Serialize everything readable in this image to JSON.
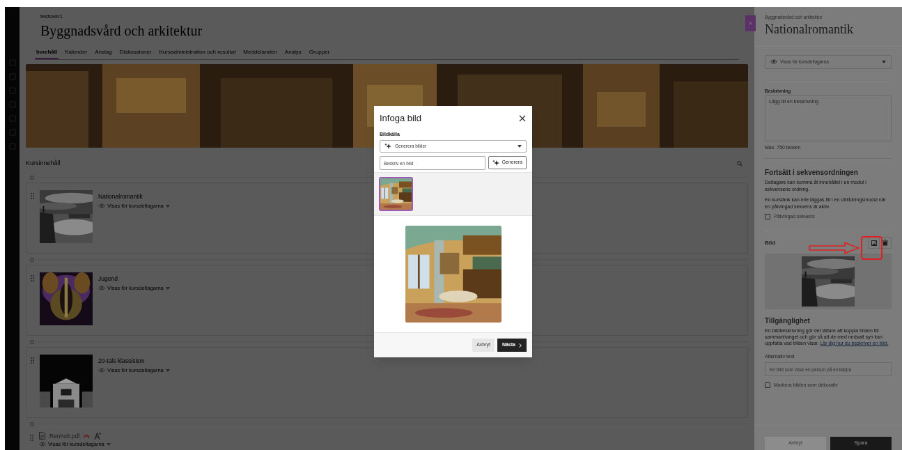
{
  "course": {
    "breadcrumb": "testcein1",
    "title": "Byggnadsvård och arkitektur"
  },
  "tabs": [
    {
      "label": "Innehåll",
      "selected": true
    },
    {
      "label": "Kalender",
      "selected": false
    },
    {
      "label": "Anslag",
      "selected": false
    },
    {
      "label": "Diskussioner",
      "selected": false
    },
    {
      "label": "Kursadministration och resultat",
      "selected": false
    },
    {
      "label": "Meddelanden",
      "selected": false
    },
    {
      "label": "Analys",
      "selected": false
    },
    {
      "label": "Grupper",
      "selected": false
    }
  ],
  "content_heading": "Kursinnehåll",
  "items": [
    {
      "kind": "module",
      "title": "Nationalromantik",
      "visibility": "Visas för kursdeltagarna"
    },
    {
      "kind": "module",
      "title": "Jugend",
      "visibility": "Visas för kursdeltagarna"
    },
    {
      "kind": "module",
      "title": "20-tals klassisism",
      "visibility": "Visas för kursdeltagarna"
    },
    {
      "kind": "file",
      "title": "Renhult.pdf",
      "visibility": "Visas för kursdeltagarna"
    }
  ],
  "dialog": {
    "title": "Infoga bild",
    "source_label": "Bildkälla",
    "source": "Generera bilder",
    "prompt_placeholder": "Beskriv en bild",
    "generate": "Generera",
    "thumbnails": [
      {
        "selected": true
      }
    ],
    "buttons": [
      "Avbryt",
      "Nästa"
    ]
  },
  "panel": {
    "context": "Byggnadsvård och arkitektur",
    "title": "Nationalromantik",
    "visibility": "Visas för kursdeltagarna",
    "description_label": "Beskrivning",
    "description_placeholder": "Lägg till en beskrivning",
    "description_hint": "Max. 750 tecken",
    "sequence_heading": "Fortsätt i sekvensordningen",
    "sequence_text": [
      "Deltagare kan komma åt innehållet i en modul i sekvensens ordning.",
      "En kurslänk kan inte läggas till i en utbildningsmodul när en påtvingad sekvens är aktiv."
    ],
    "sequence_checkbox": {
      "label": "Påtvingad sekvens",
      "checked": false
    },
    "image_heading": "Bild",
    "accessibility_heading": "Tillgänglighet",
    "accessibility_text": "En bildbeskrivning gör det lättare att koppla bilden till sammanhanget och gör så att de med nedsatt syn kan uppfatta vad bilden visar.",
    "accessibility_link": "Lär dig hur du beskriver en bild.",
    "alt_label": "Alternativ text",
    "alt_value": "En bild som visar en person på en klippa",
    "decorative_checkbox": {
      "label": "Markera bilden som dekorativ",
      "checked": false
    },
    "buttons": [
      "Avbryt",
      "Spara"
    ]
  }
}
